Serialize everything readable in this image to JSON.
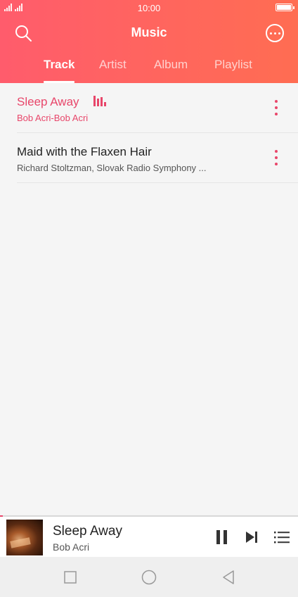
{
  "status_bar": {
    "time": "10:00"
  },
  "header": {
    "title": "Music"
  },
  "tabs": [
    {
      "label": "Track"
    },
    {
      "label": "Artist"
    },
    {
      "label": "Album"
    },
    {
      "label": "Playlist"
    }
  ],
  "tracks": [
    {
      "title": "Sleep Away",
      "subtitle": "Bob Acri-Bob Acri"
    },
    {
      "title": "Maid with the Flaxen Hair",
      "subtitle": "Richard Stoltzman, Slovak Radio Symphony ..."
    }
  ],
  "now_playing": {
    "title": "Sleep Away",
    "artist": "Bob Acri",
    "progress": 0.01
  },
  "colors": {
    "accent": "#e8466a",
    "header_start": "#ff5c6c",
    "header_end": "#ff6d52"
  },
  "icons": [
    "signal-icon",
    "battery-icon",
    "search-icon",
    "more-icon",
    "equalizer-icon",
    "overflow-menu-icon",
    "pause-icon",
    "next-icon",
    "queue-icon",
    "recent-apps-icon",
    "home-icon",
    "back-icon"
  ]
}
